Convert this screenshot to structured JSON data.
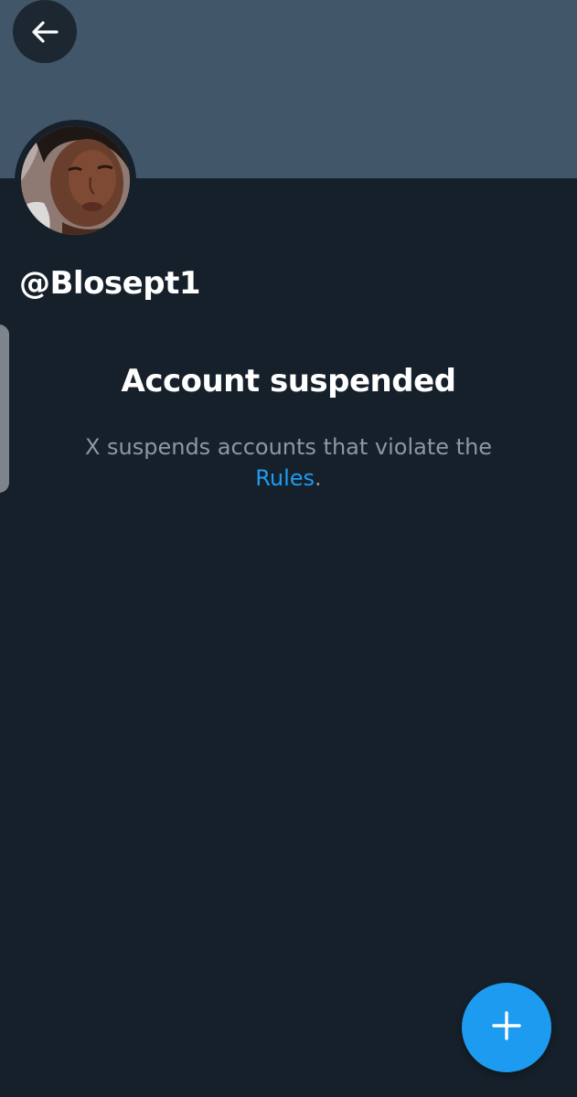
{
  "profile": {
    "handle": "@Blosept1",
    "avatar_icon": "profile-photo"
  },
  "header": {
    "back_icon": "arrow-left-icon",
    "banner_color": "#415669"
  },
  "suspension": {
    "title": "Account suspended",
    "message_prefix": "X suspends accounts that violate the ",
    "rules_link": "Rules",
    "message_suffix": "."
  },
  "fab": {
    "icon": "plus-icon",
    "color": "#1d9bf0"
  },
  "colors": {
    "background": "#16202a",
    "text_primary": "#ffffff",
    "text_secondary": "#8b98a5",
    "accent": "#1d9bf0"
  }
}
